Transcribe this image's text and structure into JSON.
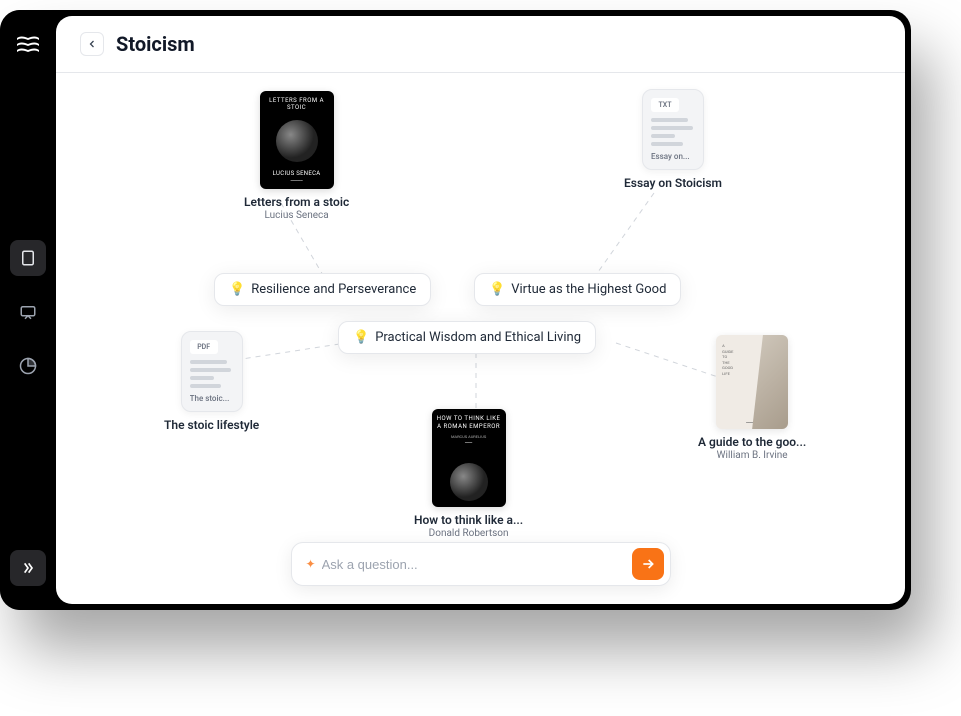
{
  "page_title": "Stoicism",
  "sidebar": {
    "items": [
      {
        "name": "book-icon",
        "active": true
      },
      {
        "name": "chat-icon",
        "active": false
      },
      {
        "name": "chart-icon",
        "active": false
      }
    ]
  },
  "concepts": [
    {
      "label": "Resilience and Perseverance"
    },
    {
      "label": "Virtue as the Highest Good"
    },
    {
      "label": "Practical Wisdom and Ethical Living"
    }
  ],
  "nodes": {
    "letters": {
      "title": "Letters from a stoic",
      "author": "Lucius Seneca",
      "cover_top": "LETTERS FROM A STOIC",
      "cover_bottom": "LUCIUS SENECA"
    },
    "essay": {
      "badge": "TXT",
      "preview_name": "Essay on...",
      "title": "Essay on Stoicism"
    },
    "lifestyle": {
      "badge": "PDF",
      "preview_name": "The stoic...",
      "title": "The stoic lifestyle"
    },
    "emperor": {
      "title": "How to think like a...",
      "author": "Donald Robertson",
      "cover_top": "HOW TO THINK LIKE A ROMAN EMPEROR",
      "cover_mid": "MARCUS AURELIUS"
    },
    "guide": {
      "title": "A guide to the goo...",
      "author": "William B. Irvine"
    }
  },
  "ask": {
    "placeholder": "Ask a question..."
  }
}
